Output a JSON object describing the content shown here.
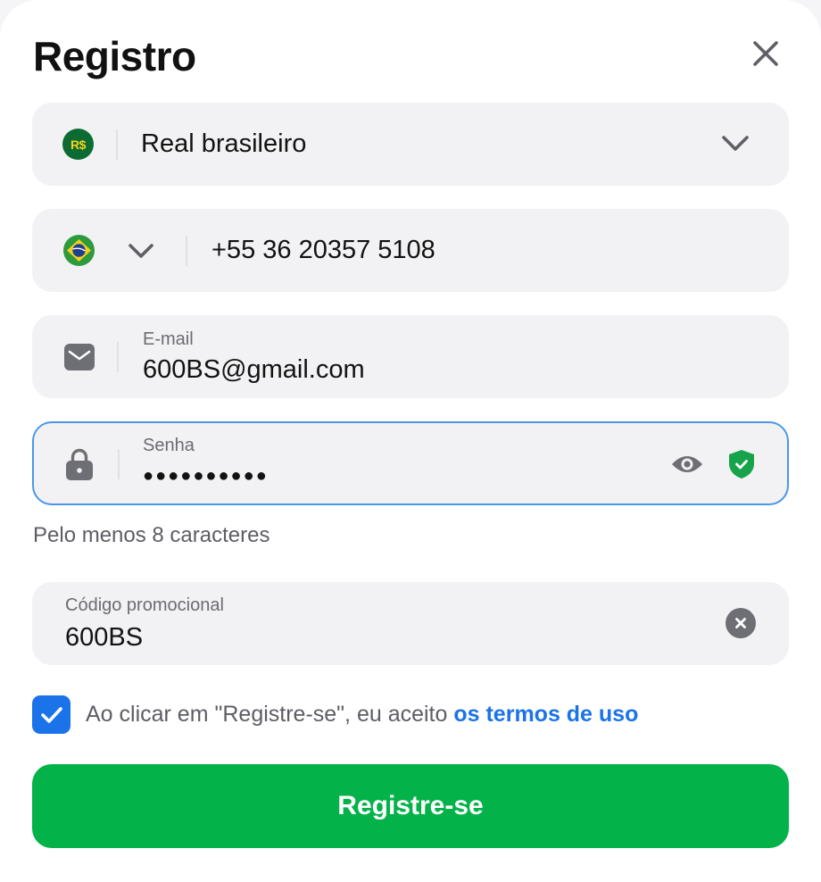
{
  "header": {
    "title": "Registro"
  },
  "currency": {
    "badge": "R$",
    "value": "Real brasileiro"
  },
  "phone": {
    "value": "+55 36 20357 5108"
  },
  "email": {
    "label": "E-mail",
    "value": "600BS@gmail.com"
  },
  "password": {
    "label": "Senha",
    "masked_value": "●●●●●●●●●●",
    "hint": "Pelo menos 8 caracteres"
  },
  "promo": {
    "label": "Código promocional",
    "value": "600BS"
  },
  "terms": {
    "checked": true,
    "text": "Ao clicar em \"Registre-se\", eu aceito ",
    "link": "os termos de uso"
  },
  "submit": {
    "label": "Registre-se"
  },
  "colors": {
    "accent_blue": "#1a73e8",
    "submit_green": "#04b24a",
    "focus_border": "#4a97e8",
    "shield_green": "#16a34a"
  }
}
